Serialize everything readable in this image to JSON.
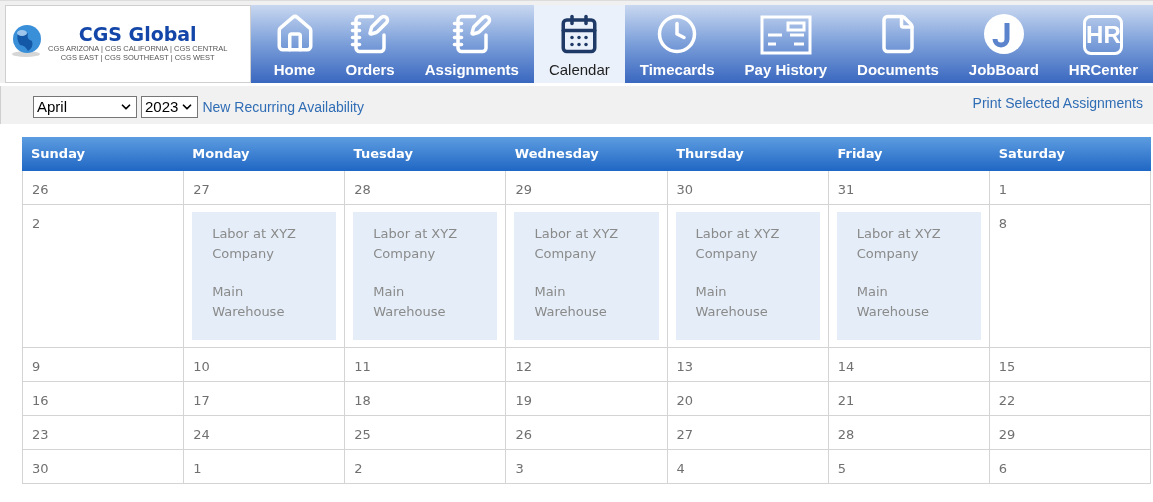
{
  "logo": {
    "title": "CGS Global",
    "subtitle_lines": [
      "CGS ARIZONA | CGS CALIFORNIA | CGS CENTRAL",
      "CGS EAST | CGS SOUTHEAST | CGS WEST"
    ]
  },
  "nav": [
    {
      "label": "Home",
      "kind": "home",
      "selected": false
    },
    {
      "label": "Orders",
      "kind": "notepad",
      "selected": false
    },
    {
      "label": "Assignments",
      "kind": "notepad",
      "selected": false
    },
    {
      "label": "Calendar",
      "kind": "calendar",
      "selected": true
    },
    {
      "label": "Timecards",
      "kind": "clock",
      "selected": false
    },
    {
      "label": "Pay History",
      "kind": "check",
      "selected": false
    },
    {
      "label": "Documents",
      "kind": "document",
      "selected": false
    },
    {
      "label": "JobBoard",
      "kind": "jobboard",
      "selected": false
    },
    {
      "label": "HRCenter",
      "kind": "hr",
      "icon_text": "HR",
      "selected": false
    }
  ],
  "toolbar": {
    "month": "April",
    "year": "2023",
    "left_link": "New Recurring Availability",
    "right_link": "Print Selected Assignments"
  },
  "calendar": {
    "days": [
      "Sunday",
      "Monday",
      "Tuesday",
      "Wednesday",
      "Thursday",
      "Friday",
      "Saturday"
    ],
    "weeks": [
      [
        {
          "day": "26"
        },
        {
          "day": "27"
        },
        {
          "day": "28"
        },
        {
          "day": "29"
        },
        {
          "day": "30"
        },
        {
          "day": "31"
        },
        {
          "day": "1"
        }
      ],
      [
        {
          "day": "2"
        },
        {
          "assignment": {
            "title": "Labor at XYZ Company",
            "location": "Main Warehouse"
          }
        },
        {
          "assignment": {
            "title": "Labor at XYZ Company",
            "location": "Main Warehouse"
          }
        },
        {
          "assignment": {
            "title": "Labor at XYZ Company",
            "location": "Main Warehouse"
          }
        },
        {
          "assignment": {
            "title": "Labor at XYZ Company",
            "location": "Main Warehouse"
          }
        },
        {
          "assignment": {
            "title": "Labor at XYZ Company",
            "location": "Main Warehouse"
          }
        },
        {
          "day": "8"
        }
      ],
      [
        {
          "day": "9"
        },
        {
          "day": "10"
        },
        {
          "day": "11"
        },
        {
          "day": "12"
        },
        {
          "day": "13"
        },
        {
          "day": "14"
        },
        {
          "day": "15"
        }
      ],
      [
        {
          "day": "16"
        },
        {
          "day": "17"
        },
        {
          "day": "18"
        },
        {
          "day": "19"
        },
        {
          "day": "20"
        },
        {
          "day": "21"
        },
        {
          "day": "22"
        }
      ],
      [
        {
          "day": "23"
        },
        {
          "day": "24"
        },
        {
          "day": "25"
        },
        {
          "day": "26"
        },
        {
          "day": "27"
        },
        {
          "day": "28"
        },
        {
          "day": "29"
        }
      ],
      [
        {
          "day": "30"
        },
        {
          "day": "1"
        },
        {
          "day": "2"
        },
        {
          "day": "3"
        },
        {
          "day": "4"
        },
        {
          "day": "5"
        },
        {
          "day": "6"
        }
      ]
    ]
  }
}
